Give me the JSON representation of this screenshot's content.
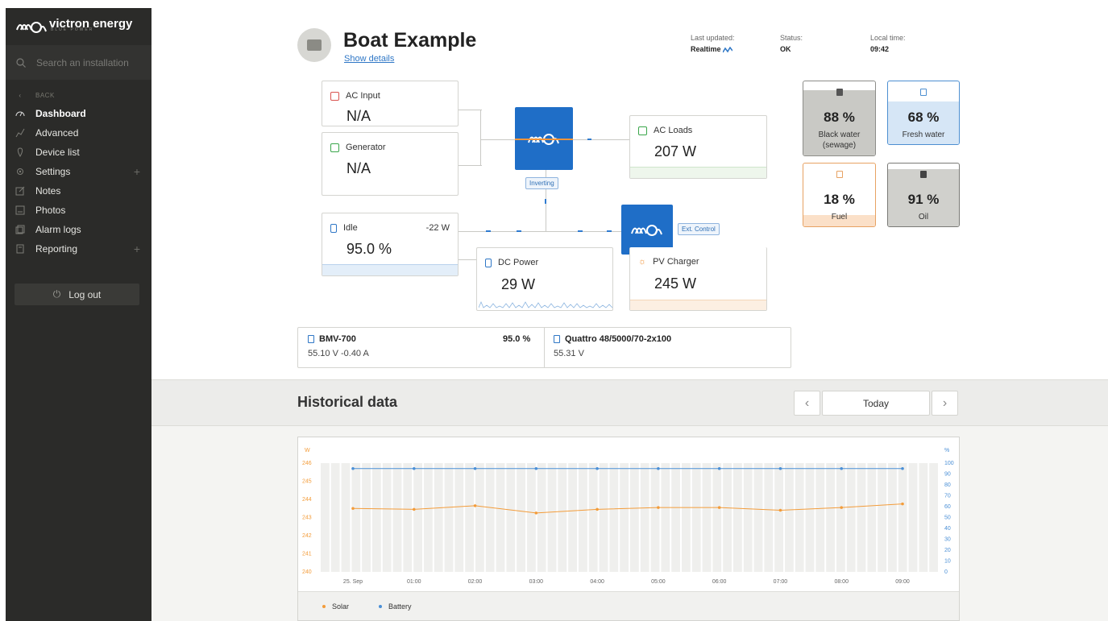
{
  "brand": {
    "name": "victron energy",
    "tagline": "BLUE POWER"
  },
  "sidebar": {
    "search_placeholder": "Search an installation",
    "back_label": "BACK",
    "items": [
      {
        "label": "Dashboard",
        "icon": "dashboard-icon",
        "active": true
      },
      {
        "label": "Advanced",
        "icon": "advanced-icon"
      },
      {
        "label": "Device list",
        "icon": "device-list-icon"
      },
      {
        "label": "Settings",
        "icon": "gear-icon",
        "expandable": true
      },
      {
        "label": "Notes",
        "icon": "notes-icon"
      },
      {
        "label": "Photos",
        "icon": "photos-icon"
      },
      {
        "label": "Alarm logs",
        "icon": "alarm-icon"
      },
      {
        "label": "Reporting",
        "icon": "reporting-icon",
        "expandable": true
      }
    ],
    "logout_label": "Log out"
  },
  "header": {
    "title": "Boat Example",
    "show_details": "Show details",
    "last_updated_label": "Last updated:",
    "last_updated_value": "Realtime",
    "status_label": "Status:",
    "status_value": "OK",
    "local_time_label": "Local time:",
    "local_time_value": "09:42"
  },
  "system": {
    "ac_input": {
      "title": "AC Input",
      "value": "N/A"
    },
    "generator": {
      "title": "Generator",
      "value": "N/A"
    },
    "inverter_state": "Inverting",
    "ac_loads": {
      "title": "AC Loads",
      "value": "207 W"
    },
    "battery": {
      "title": "Idle",
      "power": "-22 W",
      "soc": "95.0 %",
      "soc_fraction": 0.95
    },
    "dc_power": {
      "title": "DC Power",
      "value": "29 W"
    },
    "charger_state": "Ext. Control",
    "pv_charger": {
      "title": "PV Charger",
      "value": "245 W"
    }
  },
  "tanks": [
    {
      "label": "Black water (sewage)",
      "percent": "88 %",
      "level": 0.88,
      "color": "#c9c9c5",
      "border": "#8d8d89"
    },
    {
      "label": "Fresh water",
      "percent": "68 %",
      "level": 0.68,
      "color": "#d6e6f6",
      "border": "#4d8fd1"
    },
    {
      "label": "Fuel",
      "percent": "18 %",
      "level": 0.18,
      "color": "#fbe0c8",
      "border": "#e7a263"
    },
    {
      "label": "Oil",
      "percent": "91 %",
      "level": 0.91,
      "color": "#d0d0cc",
      "border": "#7a7a76"
    }
  ],
  "devices": [
    {
      "name": "BMV-700",
      "soc": "95.0 %",
      "details": "55.10 V  -0.40 A"
    },
    {
      "name": "Quattro 48/5000/70-2x100",
      "details": "55.31 V"
    }
  ],
  "historical": {
    "title": "Historical data",
    "period": "Today",
    "prev": "‹",
    "next": "›"
  },
  "chart_data": {
    "type": "line",
    "title": "",
    "xlabel": "",
    "left_unit": "W",
    "right_unit": "%",
    "categories": [
      "25. Sep",
      "01:00",
      "02:00",
      "03:00",
      "04:00",
      "05:00",
      "06:00",
      "07:00",
      "08:00",
      "09:00"
    ],
    "left_ylim": [
      240,
      246
    ],
    "left_ticks": [
      "240",
      "241",
      "242",
      "243",
      "244",
      "245",
      "246"
    ],
    "right_ylim": [
      0,
      100
    ],
    "right_ticks": [
      "0",
      "10",
      "20",
      "30",
      "40",
      "50",
      "60",
      "70",
      "80",
      "90",
      "100"
    ],
    "series": [
      {
        "name": "Solar",
        "axis": "left",
        "color": "#f39c3a",
        "values": [
          243.5,
          243.45,
          243.65,
          243.25,
          243.45,
          243.55,
          243.55,
          243.4,
          243.55,
          243.75
        ]
      },
      {
        "name": "Battery",
        "axis": "right",
        "color": "#4a8fd6",
        "values": [
          95,
          95,
          95,
          95,
          95,
          95,
          95,
          95,
          95,
          95
        ]
      }
    ]
  }
}
